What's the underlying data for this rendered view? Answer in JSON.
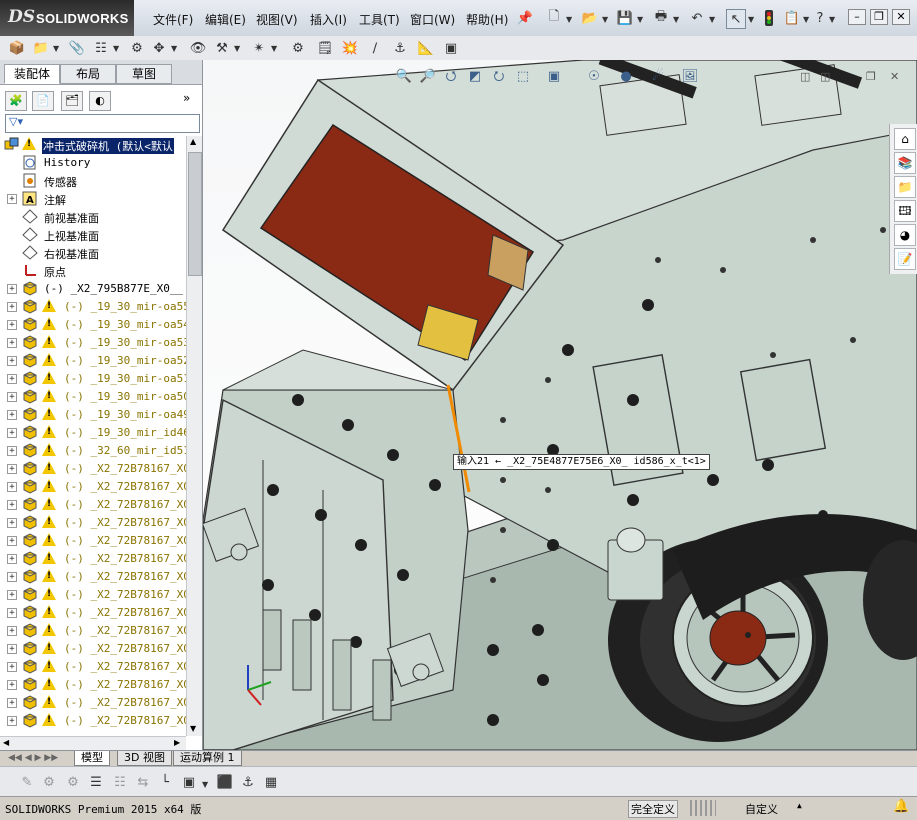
{
  "app": {
    "brand": "SOLIDWORKS",
    "brand_ds": "DS"
  },
  "menu": [
    "文件(F)",
    "编辑(E)",
    "视图(V)",
    "插入(I)",
    "工具(T)",
    "窗口(W)",
    "帮助(H)"
  ],
  "panel_tabs": [
    "装配体",
    "布局",
    "草图"
  ],
  "tree": {
    "root": "冲击式破碎机  (默认<默认",
    "items": [
      {
        "label": "History",
        "icon": "history-icon",
        "expand": false,
        "warn": false
      },
      {
        "label": "传感器",
        "icon": "sensor-icon",
        "expand": false,
        "warn": false
      },
      {
        "label": "注解",
        "icon": "annotation-icon",
        "expand": true,
        "warn": false
      },
      {
        "label": "前视基准面",
        "icon": "plane-icon",
        "expand": false,
        "warn": false
      },
      {
        "label": "上视基准面",
        "icon": "plane-icon",
        "expand": false,
        "warn": false
      },
      {
        "label": "右视基准面",
        "icon": "plane-icon",
        "expand": false,
        "warn": false
      },
      {
        "label": "原点",
        "icon": "origin-icon",
        "expand": false,
        "warn": false
      },
      {
        "label": "(-) _X2_795B877E_X0__ 20",
        "icon": "part-icon",
        "expand": true,
        "warn": false
      },
      {
        "label": "(-) _19_30_mir-oa55_i",
        "icon": "part-icon",
        "expand": true,
        "warn": true
      },
      {
        "label": "(-) _19_30_mir-oa54_i",
        "icon": "part-icon",
        "expand": true,
        "warn": true
      },
      {
        "label": "(-) _19_30_mir-oa53_i",
        "icon": "part-icon",
        "expand": true,
        "warn": true
      },
      {
        "label": "(-) _19_30_mir-oa52_i",
        "icon": "part-icon",
        "expand": true,
        "warn": true
      },
      {
        "label": "(-) _19_30_mir-oa51_i",
        "icon": "part-icon",
        "expand": true,
        "warn": true
      },
      {
        "label": "(-) _19_30_mir-oa50_i",
        "icon": "part-icon",
        "expand": true,
        "warn": true
      },
      {
        "label": "(-) _19_30_mir-oa49_i",
        "icon": "part-icon",
        "expand": true,
        "warn": true
      },
      {
        "label": "(-) _19_30_mir_id46_x",
        "icon": "part-icon",
        "expand": true,
        "warn": true
      },
      {
        "label": "(-) _32_60_mir_id51_x",
        "icon": "part-icon",
        "expand": true,
        "warn": true
      },
      {
        "label": "(-) _X2_72B78167_X0_",
        "icon": "part-icon",
        "expand": true,
        "warn": true
      },
      {
        "label": "(-) _X2_72B78167_X0_",
        "icon": "part-icon",
        "expand": true,
        "warn": true
      },
      {
        "label": "(-) _X2_72B78167_X0_",
        "icon": "part-icon",
        "expand": true,
        "warn": true
      },
      {
        "label": "(-) _X2_72B78167_X0_",
        "icon": "part-icon",
        "expand": true,
        "warn": true
      },
      {
        "label": "(-) _X2_72B78167_X0_",
        "icon": "part-icon",
        "expand": true,
        "warn": true
      },
      {
        "label": "(-) _X2_72B78167_X0_",
        "icon": "part-icon",
        "expand": true,
        "warn": true
      },
      {
        "label": "(-) _X2_72B78167_X0_",
        "icon": "part-icon",
        "expand": true,
        "warn": true
      },
      {
        "label": "(-) _X2_72B78167_X0_",
        "icon": "part-icon",
        "expand": true,
        "warn": true
      },
      {
        "label": "(-) _X2_72B78167_X0_",
        "icon": "part-icon",
        "expand": true,
        "warn": true
      },
      {
        "label": "(-) _X2_72B78167_X0_",
        "icon": "part-icon",
        "expand": true,
        "warn": true
      },
      {
        "label": "(-) _X2_72B78167_X0_",
        "icon": "part-icon",
        "expand": true,
        "warn": true
      },
      {
        "label": "(-) _X2_72B78167_X0_",
        "icon": "part-icon",
        "expand": true,
        "warn": true
      },
      {
        "label": "(-) _X2_72B78167_X0_",
        "icon": "part-icon",
        "expand": true,
        "warn": true
      },
      {
        "label": "(-) _X2_72B78167_X0_",
        "icon": "part-icon",
        "expand": true,
        "warn": true
      },
      {
        "label": "(-) _X2_72B78167_X0_",
        "icon": "part-icon",
        "expand": true,
        "warn": true
      }
    ]
  },
  "callout": "输入21 ← _X2_75E4877E75E6_X0_  id586_x_t<1>",
  "bottom_tabs": [
    "模型",
    "3D 视图",
    "运动算例 1"
  ],
  "status": {
    "product": "SOLIDWORKS Premium 2015 x64 版",
    "definition": "完全定义",
    "units": "自定义"
  },
  "colors": {
    "chrome": "#d4d0c8",
    "part_body": "#c9d6cf",
    "liner": "#8b2a14",
    "highlight_edge": "#f08a00",
    "selection": "#0a246a"
  }
}
